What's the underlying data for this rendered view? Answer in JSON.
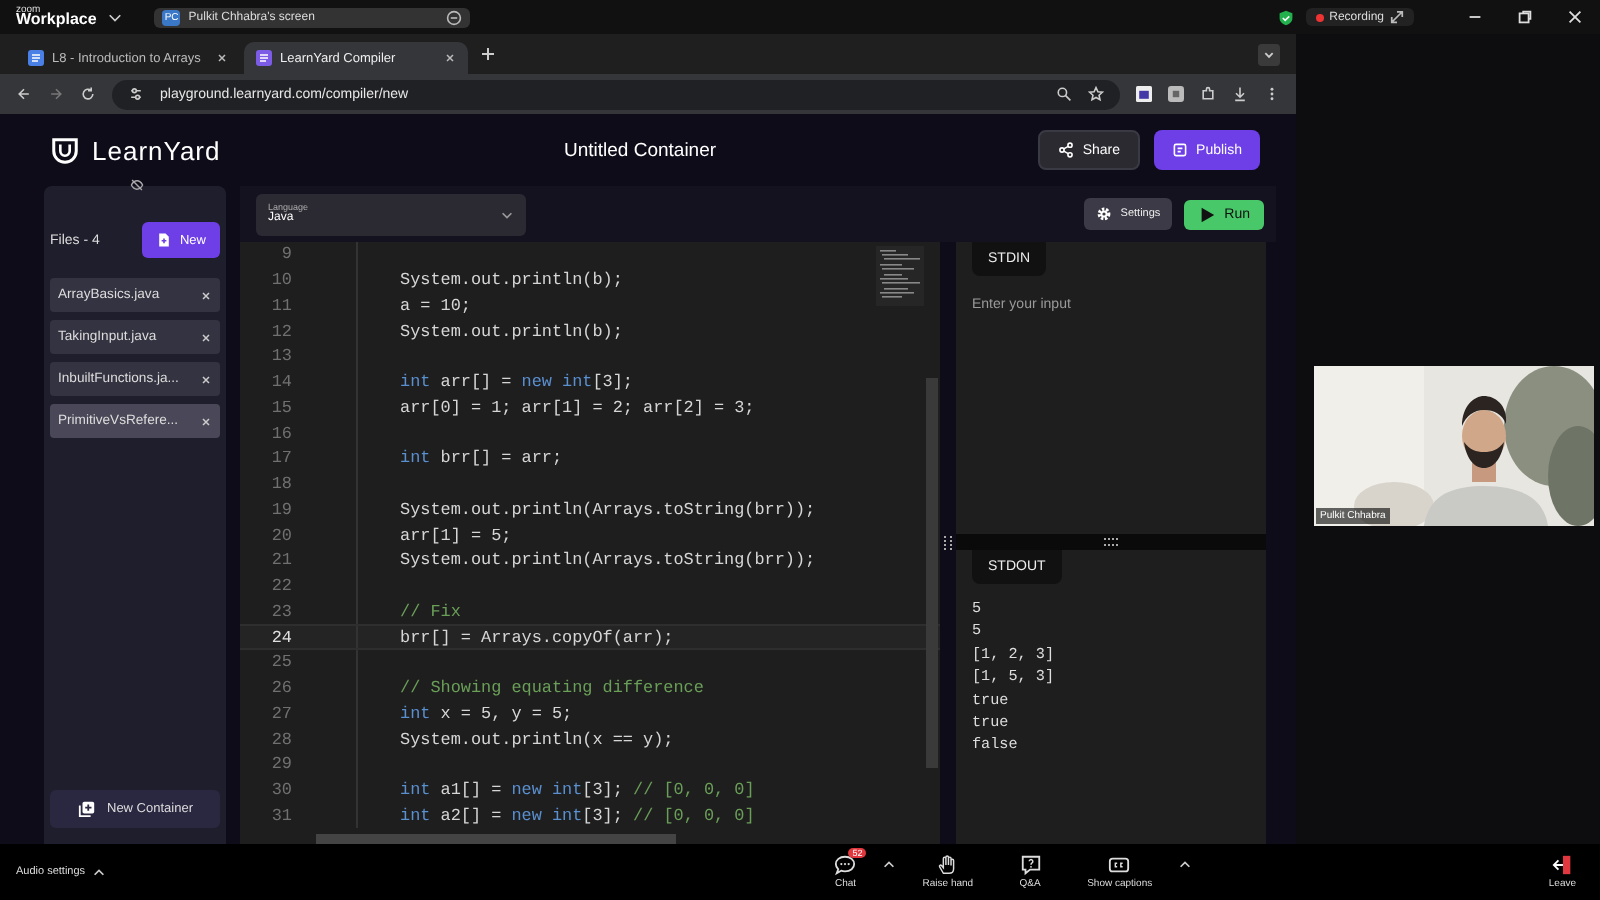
{
  "zoom_bar": {
    "logo": "zoom",
    "product": "Workplace",
    "share_tab": {
      "initials": "PC",
      "label": "Pulkit Chhabra's screen"
    },
    "recording": "Recording"
  },
  "browser": {
    "tabs": [
      {
        "title": "L8 - Introduction to Arrays",
        "selected": false
      },
      {
        "title": "LearnYard Compiler",
        "selected": true
      }
    ],
    "url": "playground.learnyard.com/compiler/new"
  },
  "app": {
    "brand": "LearnYard",
    "title": "Untitled Container",
    "share_button": "Share",
    "publish_button": "Publish"
  },
  "sidebar": {
    "files_label": "Files - 4",
    "new_button": "New",
    "files": [
      {
        "name": "ArrayBasics.java",
        "selected": false
      },
      {
        "name": "TakingInput.java",
        "selected": false
      },
      {
        "name": "InbuiltFunctions.ja...",
        "selected": false
      },
      {
        "name": "PrimitiveVsRefere...",
        "selected": true
      }
    ],
    "new_container": "New Container"
  },
  "toolbar": {
    "language_label": "Language",
    "language": "Java",
    "settings": "Settings",
    "run": "Run"
  },
  "editor": {
    "lines": [
      {
        "n": "9",
        "active": false
      },
      {
        "n": "10",
        "active": false,
        "code": [
          {
            "kind": "plain",
            "text": "System.out.println(b);"
          }
        ]
      },
      {
        "n": "11",
        "active": false,
        "code": [
          {
            "kind": "plain",
            "text": "a = 10;"
          }
        ]
      },
      {
        "n": "12",
        "active": false,
        "code": [
          {
            "kind": "plain",
            "text": "System.out.println(b);"
          }
        ]
      },
      {
        "n": "13",
        "active": false
      },
      {
        "n": "14",
        "active": false,
        "code": [
          {
            "kind": "keyword",
            "text": "int"
          },
          {
            "kind": "plain",
            "text": " arr[] = "
          },
          {
            "kind": "keyword",
            "text": "new int"
          },
          {
            "kind": "plain",
            "text": "[3];"
          }
        ]
      },
      {
        "n": "15",
        "active": false,
        "code": [
          {
            "kind": "plain",
            "text": "arr[0] = 1; arr[1] = 2; arr[2] = 3;"
          }
        ]
      },
      {
        "n": "16",
        "active": false
      },
      {
        "n": "17",
        "active": false,
        "code": [
          {
            "kind": "keyword",
            "text": "int"
          },
          {
            "kind": "plain",
            "text": " brr[] = arr;"
          }
        ]
      },
      {
        "n": "18",
        "active": false
      },
      {
        "n": "19",
        "active": false,
        "code": [
          {
            "kind": "plain",
            "text": "System.out.println(Arrays.toString(brr));"
          }
        ]
      },
      {
        "n": "20",
        "active": false,
        "code": [
          {
            "kind": "plain",
            "text": "arr[1] = 5;"
          }
        ]
      },
      {
        "n": "21",
        "active": false,
        "code": [
          {
            "kind": "plain",
            "text": "System.out.println(Arrays.toString(brr));"
          }
        ]
      },
      {
        "n": "22",
        "active": false
      },
      {
        "n": "23",
        "active": false,
        "code": [
          {
            "kind": "comment",
            "text": "// Fix"
          }
        ]
      },
      {
        "n": "24",
        "active": true,
        "code": [
          {
            "kind": "plain",
            "text": "brr[] = Arrays.copyOf(arr);"
          }
        ]
      },
      {
        "n": "25",
        "active": false
      },
      {
        "n": "26",
        "active": false,
        "code": [
          {
            "kind": "comment",
            "text": "// Showing equating difference"
          }
        ]
      },
      {
        "n": "27",
        "active": false,
        "code": [
          {
            "kind": "keyword",
            "text": "int"
          },
          {
            "kind": "plain",
            "text": " x = 5, y = 5;"
          }
        ]
      },
      {
        "n": "28",
        "active": false,
        "code": [
          {
            "kind": "plain",
            "text": "System.out.println(x == y);"
          }
        ]
      },
      {
        "n": "29",
        "active": false
      },
      {
        "n": "30",
        "active": false,
        "code": [
          {
            "kind": "keyword",
            "text": "int"
          },
          {
            "kind": "plain",
            "text": " a1[] = "
          },
          {
            "kind": "keyword",
            "text": "new int"
          },
          {
            "kind": "plain",
            "text": "[3]; "
          },
          {
            "kind": "comment",
            "text": "// [0, 0, 0]"
          }
        ]
      },
      {
        "n": "31",
        "active": false,
        "code": [
          {
            "kind": "keyword",
            "text": "int"
          },
          {
            "kind": "plain",
            "text": " a2[] = "
          },
          {
            "kind": "keyword",
            "text": "new int"
          },
          {
            "kind": "plain",
            "text": "[3]; "
          },
          {
            "kind": "comment",
            "text": "// [0, 0, 0]"
          }
        ]
      }
    ]
  },
  "stdin": {
    "title": "STDIN",
    "placeholder": "Enter your input"
  },
  "stdout": {
    "title": "STDOUT",
    "lines": [
      "5",
      "5",
      "[1, 2, 3]",
      "[1, 5, 3]",
      "true",
      "true",
      "false"
    ]
  },
  "participant": {
    "name": "Pulkit Chhabra"
  },
  "meeting_controls": {
    "audio": "Audio settings",
    "items": [
      {
        "kind": "chat",
        "label": "Chat",
        "badge": "52"
      },
      {
        "kind": "hand",
        "label": "Raise hand"
      },
      {
        "kind": "qa",
        "label": "Q&A"
      },
      {
        "kind": "captions",
        "label": "Show captions"
      }
    ],
    "leave": "Leave"
  }
}
